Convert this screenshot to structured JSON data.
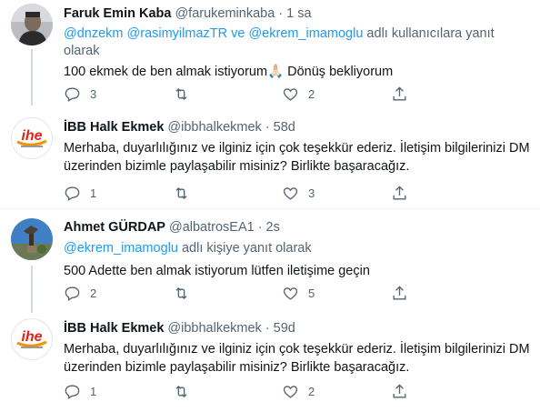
{
  "tweets": [
    {
      "name": "Faruk Emin Kaba",
      "handle": "@farukeminkaba",
      "time": "· 1 sa",
      "reply_mentions": "@dnzekm @rasimyilmazTR ve @ekrem_imamoglu",
      "reply_suffix": " adlı kullanıcılara yanıt olarak",
      "text": "100 ekmek de ben almak istiyorum🙏🏻 Dönüş bekliyorum",
      "replies": "3",
      "retweets": "",
      "likes": "2"
    },
    {
      "name": "İBB Halk Ekmek",
      "handle": "@ibbhalkekmek",
      "time": "· 58d",
      "text": "Merhaba, duyarlılığınız ve ilginiz için çok teşekkür ederiz. İletişim bilgilerinizi DM üzerinden bizimle paylaşabilir misiniz? Birlikte başaracağız.",
      "replies": "1",
      "retweets": "",
      "likes": "3"
    },
    {
      "name": "Ahmet GÜRDAP",
      "handle": "@albatrosEA1",
      "time": "· 2s",
      "reply_mentions": "@ekrem_imamoglu",
      "reply_suffix": " adlı kişiye yanıt olarak",
      "text": "500 Adette ben almak istiyorum lütfen iletişime geçin",
      "replies": "2",
      "retweets": "",
      "likes": "5"
    },
    {
      "name": "İBB Halk Ekmek",
      "handle": "@ibbhalkekmek",
      "time": "· 59d",
      "text": "Merhaba, duyarlılığınız ve ilginiz için çok teşekkür ederiz. İletişim bilgilerinizi DM üzerinden bizimle paylaşabilir misiniz? Birlikte başaracağız.",
      "replies": "1",
      "retweets": "",
      "likes": "2"
    }
  ],
  "logo_text": "ihe",
  "colors": {
    "mention": "#1d9bf0",
    "muted": "#536471",
    "logo_red": "#e2231a",
    "logo_orange": "#f39200"
  },
  "icons": [
    "reply-icon",
    "retweet-icon",
    "like-icon",
    "share-icon"
  ]
}
